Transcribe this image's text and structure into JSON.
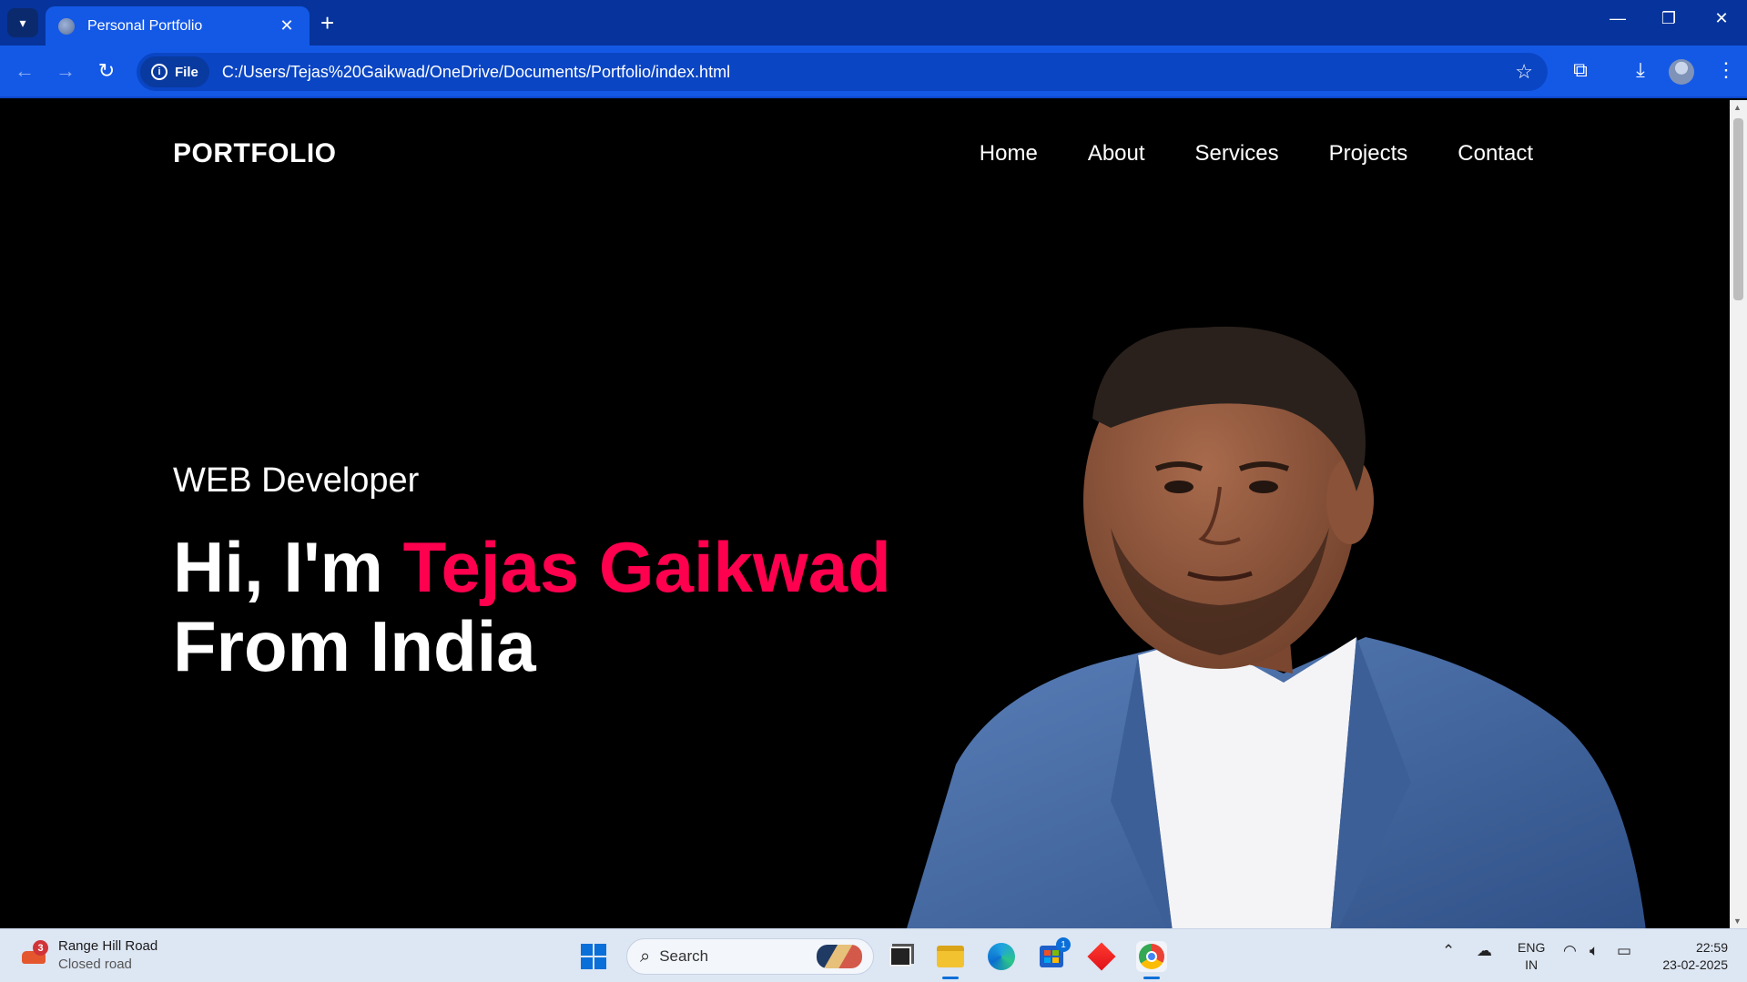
{
  "browser": {
    "tab_title": "Personal Portfolio",
    "tab_close": "✕",
    "new_tab": "+",
    "window_controls": {
      "minimize": "—",
      "restore": "❐",
      "close": "✕"
    },
    "site_chip": "File",
    "url": "C:/Users/Tejas%20Gaikwad/OneDrive/Documents/Portfolio/index.html"
  },
  "page": {
    "logo": "PORTFOLIO",
    "nav": [
      "Home",
      "About",
      "Services",
      "Projects",
      "Contact"
    ],
    "role": "WEB Developer",
    "greeting": "Hi, I'm ",
    "name": "Tejas Gaikwad",
    "origin": "From India",
    "accent_color": "#ff004f"
  },
  "taskbar": {
    "weather_title": "Range Hill Road",
    "weather_sub": "Closed road",
    "weather_badge": "3",
    "search_label": "Search",
    "store_badge": "1",
    "lang_line1": "ENG",
    "lang_line2": "IN",
    "time": "22:59",
    "date": "23-02-2025"
  }
}
